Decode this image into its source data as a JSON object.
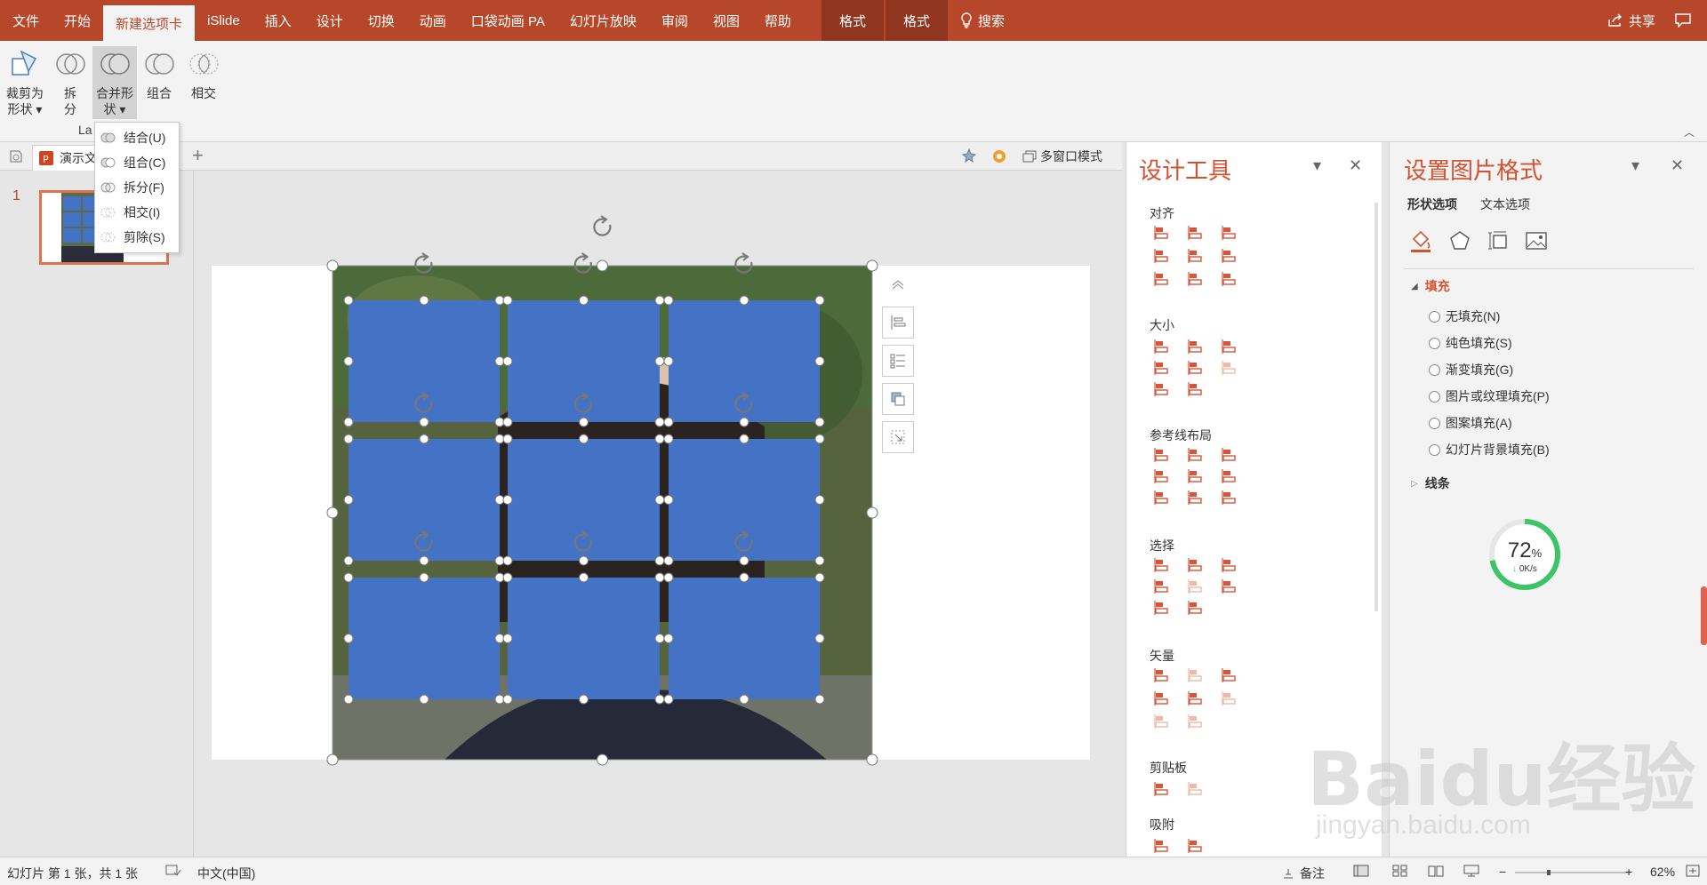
{
  "tabs": [
    {
      "label": "文件",
      "state": "normal"
    },
    {
      "label": "开始",
      "state": "normal"
    },
    {
      "label": "新建选项卡",
      "state": "active"
    },
    {
      "label": "iSlide",
      "state": "normal"
    },
    {
      "label": "插入",
      "state": "normal"
    },
    {
      "label": "设计",
      "state": "normal"
    },
    {
      "label": "切换",
      "state": "normal"
    },
    {
      "label": "动画",
      "state": "normal"
    },
    {
      "label": "口袋动画 PA",
      "state": "normal"
    },
    {
      "label": "幻灯片放映",
      "state": "normal"
    },
    {
      "label": "审阅",
      "state": "normal"
    },
    {
      "label": "视图",
      "state": "normal"
    },
    {
      "label": "帮助",
      "state": "normal"
    },
    {
      "label": "格式",
      "state": "contextual"
    },
    {
      "label": "格式",
      "state": "contextual"
    }
  ],
  "search_label": "搜索",
  "share_label": "共享",
  "ribbon": {
    "buttons": [
      {
        "line1": "裁剪为",
        "line2": "形状 ▾",
        "icon": "crop-to-shape-icon"
      },
      {
        "line1": "拆",
        "line2": "分",
        "icon": "split-icon"
      },
      {
        "line1": "合并形",
        "line2": "状 ▾",
        "icon": "merge-shapes-icon"
      },
      {
        "line1": "组合",
        "line2": "",
        "icon": "combine-icon"
      },
      {
        "line1": "相交",
        "line2": "",
        "icon": "intersect-icon"
      }
    ],
    "group_label": "La"
  },
  "merge_menu": [
    {
      "label": "结合(U)",
      "icon": "union-icon"
    },
    {
      "label": "组合(C)",
      "icon": "combine-icon"
    },
    {
      "label": "拆分(F)",
      "icon": "fragment-icon"
    },
    {
      "label": "相交(I)",
      "icon": "intersect-icon"
    },
    {
      "label": "剪除(S)",
      "icon": "subtract-icon"
    }
  ],
  "doc_tab": {
    "label": "演示文",
    "new_tab": "+"
  },
  "multi_window_label": "多窗口模式",
  "slide_number": "1",
  "design_pane": {
    "title": "设计工具",
    "sections": [
      "对齐",
      "大小",
      "参考线布局",
      "选择",
      "矢量",
      "剪贴板",
      "吸附"
    ]
  },
  "format_pane": {
    "title": "设置图片格式",
    "subtabs": [
      "形状选项",
      "文本选项"
    ],
    "fill_section": "填充",
    "fill_options": [
      "无填充(N)",
      "纯色填充(S)",
      "渐变填充(G)",
      "图片或纹理填充(P)",
      "图案填充(A)",
      "幻灯片背景填充(B)"
    ],
    "line_section": "线条"
  },
  "speed_widget": {
    "percent": "72",
    "unit": "%",
    "rate": "0K/s"
  },
  "watermark": {
    "text": "Baidu经验",
    "url": "jingyan.baidu.com"
  },
  "statusbar": {
    "slide_info": "幻灯片 第 1 张，共 1 张",
    "language": "中文(中国)",
    "notes": "备注",
    "zoom": "62%"
  },
  "colors": {
    "accent": "#b7472a",
    "shape_fill": "#4472c4",
    "pane_title": "#d35230"
  }
}
